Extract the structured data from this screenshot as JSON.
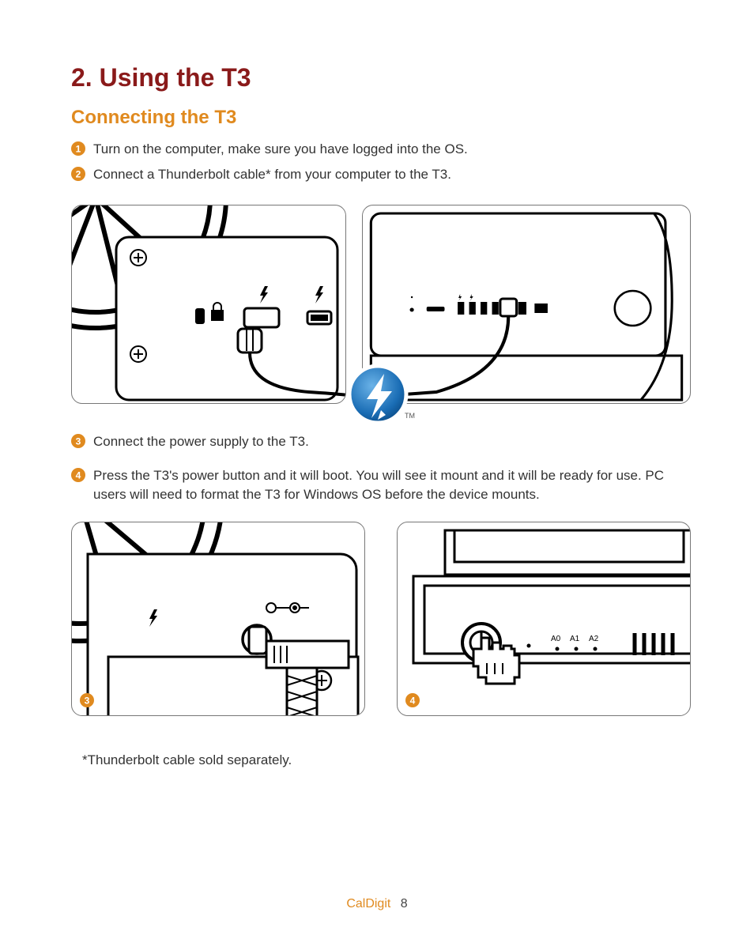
{
  "heading": "2. Using the T3",
  "subheading": "Connecting the T3",
  "steps": {
    "s1": "Turn on the computer, make sure you have logged into the OS.",
    "s2": "Connect a Thunderbolt cable* from your computer to the T3.",
    "s3": "Connect the power supply to the T3.",
    "s4": "Press the T3's power button and it will boot.  You will see it mount and it will be ready for use. PC users will need to format the T3 for Windows OS before the device mounts."
  },
  "badges": {
    "n1": "1",
    "n2": "2",
    "n3": "3",
    "n4": "4"
  },
  "tb_tm": "TM",
  "led_labels": {
    "a0": "A0",
    "a1": "A1",
    "a2": "A2"
  },
  "footnote": "*Thunderbolt cable sold separately.",
  "footer": {
    "brand": "CalDigit",
    "page": "8"
  }
}
